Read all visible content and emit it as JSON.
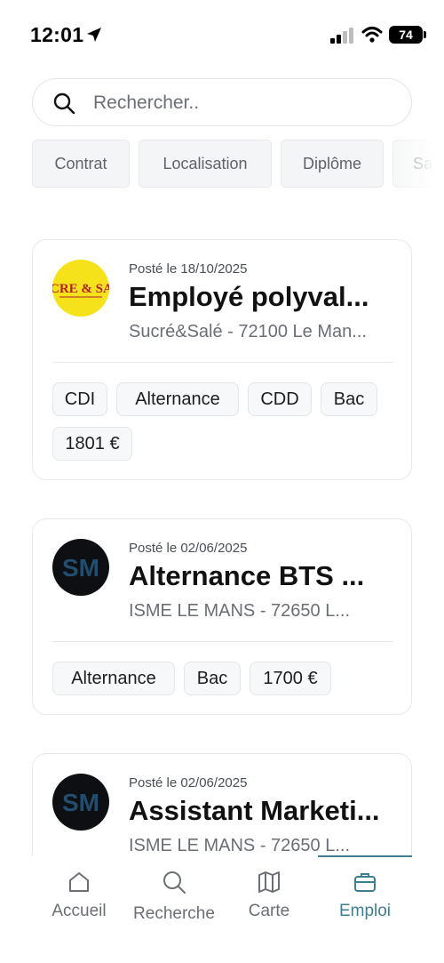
{
  "status_bar": {
    "time": "12:01",
    "battery": "74"
  },
  "search": {
    "placeholder": "Rechercher.."
  },
  "filters": [
    "Contrat",
    "Localisation",
    "Diplôme",
    "Sa"
  ],
  "jobs": [
    {
      "posted": "Posté le 18/10/2025",
      "title": "Employé polyval...",
      "company": "Sucré&Salé - 72100 Le Man...",
      "logo_text": "UCRE & SAL",
      "tags": [
        "CDI",
        "Alternance",
        "CDD",
        "Bac",
        "1801 €"
      ]
    },
    {
      "posted": "Posté le 02/06/2025",
      "title": "Alternance BTS ...",
      "company": "ISME LE MANS  - 72650 L...",
      "logo_text": "SM",
      "tags": [
        "Alternance",
        "Bac",
        "1700 €"
      ]
    },
    {
      "posted": "Posté le 02/06/2025",
      "title": "Assistant Marketi...",
      "company": "ISME LE MANS  - 72650 L...",
      "logo_text": "SM",
      "tags": []
    }
  ],
  "nav": {
    "items": [
      {
        "label": "Accueil",
        "icon": "home-icon"
      },
      {
        "label": "Recherche",
        "icon": "search-icon"
      },
      {
        "label": "Carte",
        "icon": "map-icon"
      },
      {
        "label": "Emploi",
        "icon": "briefcase-icon"
      }
    ],
    "active": "Emploi"
  },
  "colors": {
    "accent": "#3d7f90",
    "sucre_logo_bg": "#f6e21a",
    "isme_logo_bg": "#0d0f12"
  }
}
